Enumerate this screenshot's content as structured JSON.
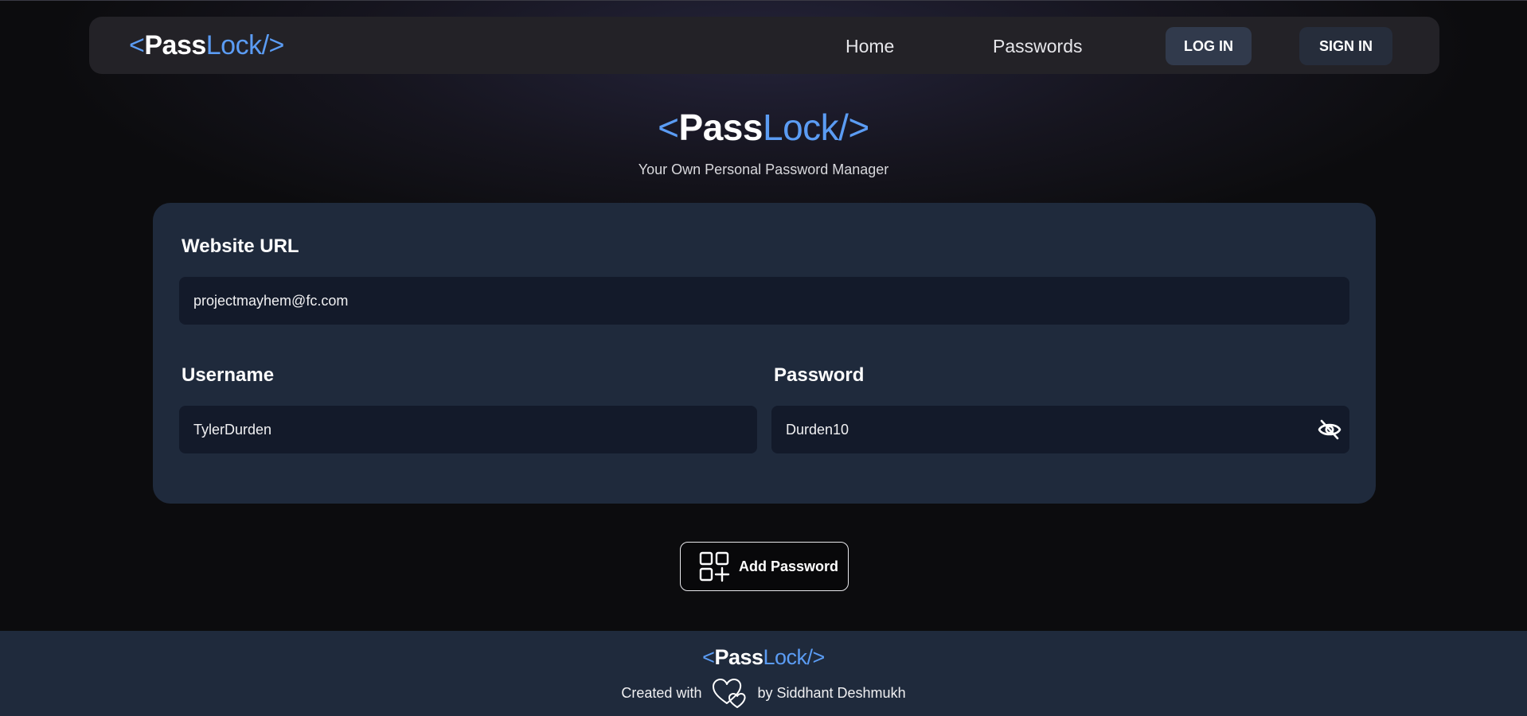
{
  "brand": {
    "open": "<",
    "pass": "Pass",
    "lock": "Lock",
    "close": "/>"
  },
  "nav": {
    "home": "Home",
    "passwords": "Passwords",
    "login": "LOG IN",
    "signin": "SIGN IN"
  },
  "hero": {
    "tagline": "Your Own Personal Password Manager"
  },
  "form": {
    "url_label": "Website URL",
    "url_value": "projectmayhem@fc.com",
    "username_label": "Username",
    "username_value": "TylerDurden",
    "password_label": "Password",
    "password_value": "Durden10",
    "toggle_icon": "eye-slash-icon"
  },
  "add_button": {
    "label": "Add Password",
    "icon": "add-grid-icon"
  },
  "footer": {
    "created_with": "Created with",
    "by": "by Siddhant Deshmukh",
    "icon": "hearts-icon"
  },
  "colors": {
    "accent": "#5b9cf4",
    "card": "#1f2a3c",
    "field": "#131a2a",
    "navbar": "#232227"
  }
}
